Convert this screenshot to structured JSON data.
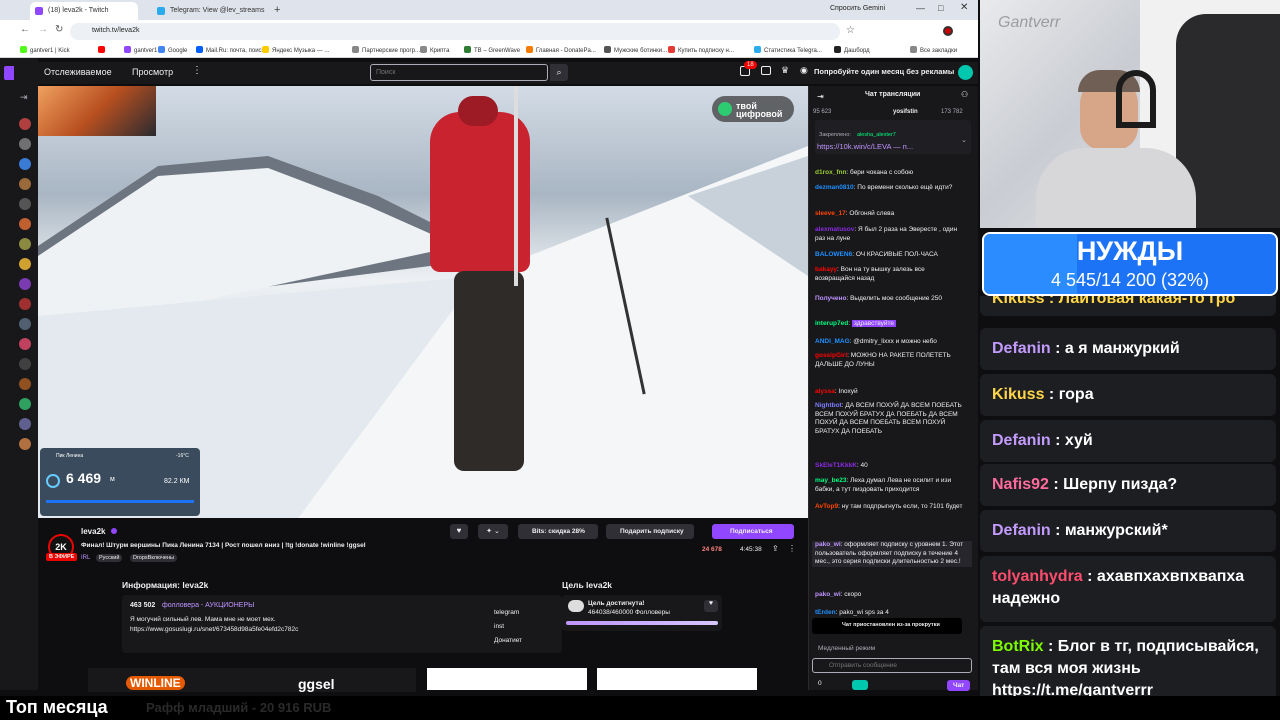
{
  "browser": {
    "tabs": [
      {
        "label": "(18) leva2k - Twitch",
        "active": true,
        "favicon_color": "#9146ff"
      },
      {
        "label": "Telegram: View @lev_streams",
        "active": false,
        "favicon_color": "#2aabee"
      }
    ],
    "gemini_button": "Спросить Gemini",
    "url": "twitch.tv/leva2k",
    "bookmarks": [
      {
        "label": "gantver1 | Kick",
        "color": "#53fc18"
      },
      {
        "label": "",
        "color": "#ff0000"
      },
      {
        "label": "gantver1",
        "color": "#9146ff"
      },
      {
        "label": "Google",
        "color": "#4285f4"
      },
      {
        "label": "Mail.Ru: почта, поиск...",
        "color": "#005ff9"
      },
      {
        "label": "Яндекс Музыка — ...",
        "color": "#ffcc00"
      },
      {
        "label": "Партнерские прогр...",
        "color": "#888888"
      },
      {
        "label": "Крипта",
        "color": "#888888"
      },
      {
        "label": "TB – GreenWave",
        "color": "#2e7d32"
      },
      {
        "label": "Главная - DonatePa...",
        "color": "#f57c00"
      },
      {
        "label": "Мужские ботинки...",
        "color": "#555555"
      },
      {
        "label": "Купить подписку н...",
        "color": "#e53935"
      },
      {
        "label": "Статистика Telegra...",
        "color": "#2aabee"
      },
      {
        "label": "Дашборд",
        "color": "#222222"
      },
      {
        "label": "Все закладки",
        "color": "#888888"
      }
    ]
  },
  "twitch": {
    "nav": {
      "following": "Отслеживаемое",
      "browse": "Просмотр",
      "search_placeholder": "Поиск",
      "notif_count": "18",
      "prime_text": "Попробуйте один месяц без рекламы"
    },
    "video": {
      "sponsor_badge": "твой цифровой",
      "telemetry": {
        "title": "Пик Ленина",
        "value": "6 469",
        "unit": "м",
        "speed": "82.2 КМ",
        "temp": "-16°C"
      }
    },
    "channel": {
      "name": "leva2k",
      "live_label": "В ЭФИРЕ",
      "title": "Финал! Штурм вершины Пика Ленина 7134 | Рост пошел вниз | !tg !donate !winline !ggsel",
      "category": "IRL",
      "tags": [
        "Русский",
        "DropsВключены"
      ],
      "viewers": "24 678",
      "uptime": "4:45:38",
      "bits_label": "Bits: скидка 28%",
      "gift_label": "Подарить подписку",
      "subscribe_label": "Подписаться",
      "logo_text": "2K"
    },
    "info": {
      "title": "Информация: leva2k",
      "followers": "463 502",
      "followers_suffix": "фолловера - АУКЦИОНЕРЫ",
      "bio": "Я могучий сильный лев. Мама мне не моет мех.",
      "link": "https://www.gosuslugi.ru/snet/673458d98a5fe04efd2c782c",
      "social": [
        "telegram",
        "inst",
        "Донатиет"
      ],
      "goal_title": "Цель leva2k",
      "goal_reached": "Цель достигнута!",
      "goal_progress": "464038/460000 Фолловеры",
      "goal_fraction": 1.0,
      "banners": [
        "WINLINE",
        "ggsel"
      ]
    },
    "chat": {
      "header": "Чат трансляции",
      "viewer_count": "95 623",
      "top_user": "yosifstin",
      "top_amount": "173 782",
      "pinned_label": "Закреплено:",
      "pinned_user": "alesha_alexter7",
      "pinned_link": "https://10k.win/c/LEVA — п...",
      "messages": [
        {
          "user": "d1rox_fnn",
          "text": "бери чокана с собою",
          "color": "#9acd32"
        },
        {
          "user": "dezman0810",
          "text": "По времени сколько ещё идти?",
          "color": "#1e90ff"
        },
        {
          "user": "sleeve_17",
          "text": "Обгоняй слева",
          "color": "#ff4500"
        },
        {
          "user": "alexmatusov",
          "text": "Я был 2 раза на Эвересте , один раз на луне",
          "color": "#8a2be2"
        },
        {
          "user": "BALOWEN6",
          "text": "ОЧ КРАСИВЫЕ ПОЛ-ЧАСА",
          "color": "#1e90ff"
        },
        {
          "user": "bakayy",
          "text": "Вон на ту вышку залезь все возвращайся назад",
          "color": "#ff0000"
        },
        {
          "user": "Получено",
          "text": "Выделить мое сообщение 250",
          "color": "#bf94ff"
        },
        {
          "user": "interup7ed",
          "text": "здравствуйте",
          "color": "#00ff7f"
        },
        {
          "user": "ANDI_MAG",
          "text": "@dmitry_lixxx и можно небо",
          "color": "#1e90ff"
        },
        {
          "user": "gossipGirl",
          "text": "МОЖНО НА РАКЕТЕ ПОЛЕТЕТЬ ДАЛЬШЕ ДО ЛУНЫ",
          "color": "#ff0000"
        },
        {
          "user": "alyssa",
          "text": "Inoxyй",
          "color": "#ff0000"
        },
        {
          "user": "Nightbot",
          "text": "ДА ВСЕМ ПОХУЙ ДА ВСЕМ ПОЕБАТЬ ВСЕМ ПОХУЙ БРАТУХ ДА ПОЕБАТЬ ДА ВСЕМ ПОХУЙ ДА ВСЕМ ПОЕБАТЬ ВСЕМ ПОХУЙ БРАТУХ ДА ПОЕБАТЬ",
          "color": "#7c7cff"
        },
        {
          "user": "SkEleT1KkkK",
          "text": "40",
          "color": "#8a2be2"
        },
        {
          "user": "may_be23",
          "text": "Леха думал Лева не осилит и изи бабки, а тут пиздовать приходится",
          "color": "#00ff7f"
        },
        {
          "user": "AvTop9",
          "text": "ну там подпрыгнуть если, то 7101 будет",
          "color": "#ff4500"
        },
        {
          "user": "pako_wi",
          "text": "оформляет подписку с уровнем 1. Этот пользователь оформляет подписку в течение 4 мес., это серия подписки длительностью 2 мес.!",
          "color": "#bf94ff"
        },
        {
          "user": "pako_wi",
          "text": "скоро",
          "color": "#bf94ff"
        },
        {
          "user": "tErden",
          "text": "pako_wi sps за 4",
          "color": "#1e90ff"
        }
      ],
      "paused_label": "Чат приостановлен из-за прокрутки",
      "slow_mode": "Медленный режим",
      "input_placeholder": "Отправить сообщение",
      "points": "0",
      "chat_button": "Чат"
    }
  },
  "overlay": {
    "watermark": "Gantverr",
    "goal_title": "НУЖДЫ",
    "goal_text": "4 545/14 200 (32%)",
    "goal_fraction": 0.32,
    "top_partial": "Kikuss : Лайтовая какая-то гро",
    "messages": [
      {
        "user": "Defanin",
        "text": ": а я манжуркий",
        "color": "#c39bff"
      },
      {
        "user": "Kikuss",
        "text": ": гора",
        "color": "#ffd54a"
      },
      {
        "user": "Defanin",
        "text": ": хуй",
        "color": "#c39bff"
      },
      {
        "user": "Nafis92",
        "text": ": Шерпу пизда?",
        "color": "#ff6b9d"
      },
      {
        "user": "Defanin",
        "text": ": манжурский*",
        "color": "#c39bff"
      },
      {
        "user": "tolyanhydra",
        "text": ": ахавпхахвпхвапха надежно",
        "color": "#ff4d6d"
      },
      {
        "user": "BotRix",
        "text": ": Блог в тг, подписывайся, там вся моя жизнь https://t.me/gantverrr",
        "color": "#7cfc00"
      }
    ],
    "bottom_title": "Топ месяца",
    "bottom_text": "Рафф младший - 20 916 RUB"
  }
}
